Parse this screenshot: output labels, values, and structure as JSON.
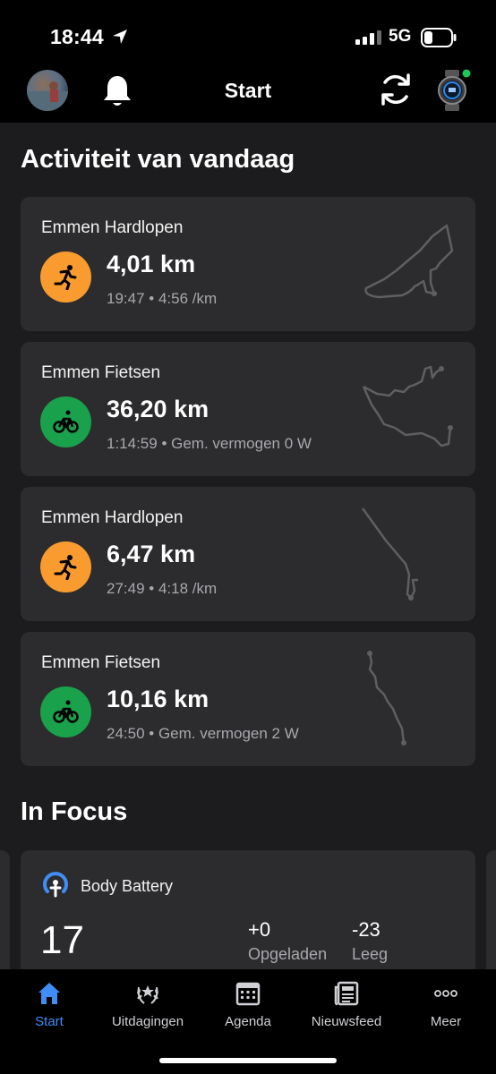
{
  "status": {
    "time": "18:44",
    "network": "5G"
  },
  "header": {
    "title": "Start"
  },
  "today": {
    "title": "Activiteit van vandaag",
    "activities": [
      {
        "name": "Emmen Hardlopen",
        "type": "run",
        "distance": "4,01 km",
        "meta": "19:47 • 4:56 /km"
      },
      {
        "name": "Emmen Fietsen",
        "type": "bike",
        "distance": "36,20 km",
        "meta": "1:14:59 • Gem. vermogen 0 W"
      },
      {
        "name": "Emmen Hardlopen",
        "type": "run",
        "distance": "6,47 km",
        "meta": "27:49 • 4:18 /km"
      },
      {
        "name": "Emmen Fietsen",
        "type": "bike",
        "distance": "10,16 km",
        "meta": "24:50 • Gem. vermogen 2 W"
      }
    ]
  },
  "focus": {
    "title": "In Focus",
    "body_battery": {
      "title": "Body Battery",
      "value": "17",
      "charged_value": "+0",
      "charged_label": "Opgeladen",
      "drained_value": "-23",
      "drained_label": "Leeg"
    }
  },
  "tabs": [
    {
      "label": "Start",
      "icon": "home-icon",
      "active": true
    },
    {
      "label": "Uitdagingen",
      "icon": "laurel-icon"
    },
    {
      "label": "Agenda",
      "icon": "calendar-icon"
    },
    {
      "label": "Nieuwsfeed",
      "icon": "newsfeed-icon"
    },
    {
      "label": "Meer",
      "icon": "more-icon"
    }
  ],
  "colors": {
    "run": "#f99b2e",
    "bike": "#1aa14b",
    "accent": "#3f8ef6"
  }
}
